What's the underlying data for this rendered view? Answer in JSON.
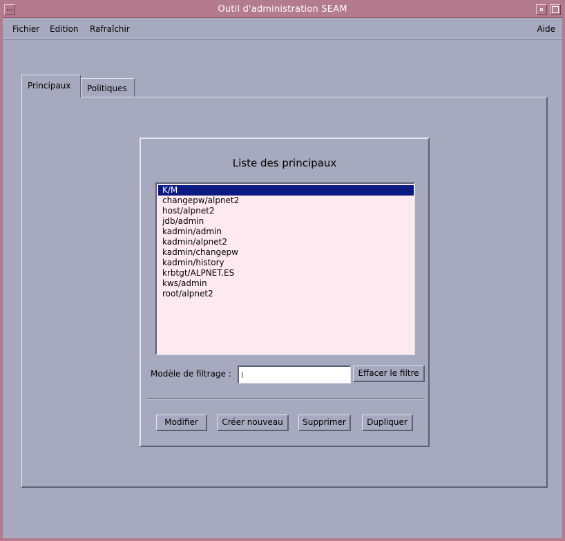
{
  "window": {
    "title": "Outil d'administration SEAM"
  },
  "menubar": {
    "items": [
      "Fichier",
      "Edition",
      "Rafraîchir"
    ],
    "help": "Aide"
  },
  "tabs": [
    {
      "label": "Principaux",
      "active": true
    },
    {
      "label": "Politiques",
      "active": false
    }
  ],
  "principals_panel": {
    "title": "Liste des principaux",
    "items": [
      "K/M",
      "changepw/alpnet2",
      "host/alpnet2",
      "jdb/admin",
      "kadmin/admin",
      "kadmin/alpnet2",
      "kadmin/changepw",
      "kadmin/history",
      "krbtgt/ALPNET.ES",
      "kws/admin",
      "root/alpnet2"
    ],
    "selected_item": "K/M",
    "filter": {
      "label": "Modèle de filtrage :",
      "value": "",
      "clear_button": "Effacer le filtre"
    },
    "actions": {
      "modify": "Modifier",
      "create": "Créer nouveau",
      "delete": "Supprimer",
      "duplicate": "Dupliquer"
    }
  },
  "colors": {
    "titlebar": "#b47a8e",
    "background": "#a7a9be",
    "list_background": "#fde9ef",
    "selection": "#0a1a82"
  }
}
